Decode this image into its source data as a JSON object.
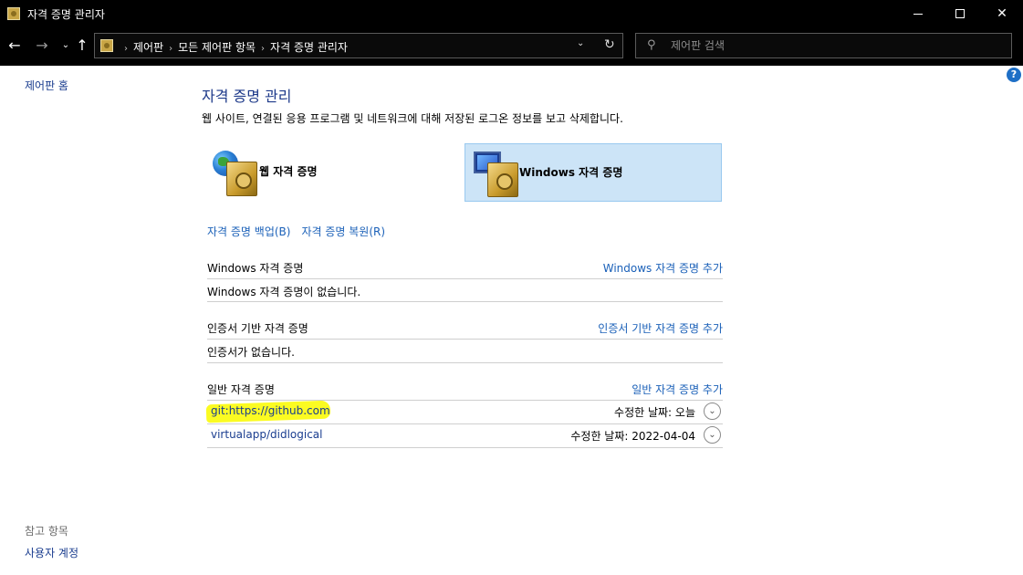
{
  "window": {
    "title": "자격 증명 관리자",
    "controls": {
      "minimize": "",
      "maximize": "",
      "close": "✕"
    }
  },
  "nav": {
    "back": "←",
    "forward": "→",
    "recent": "⌄",
    "up": "↑",
    "breadcrumbs": [
      "제어판",
      "모든 제어판 항목",
      "자격 증명 관리자"
    ],
    "separator": "›",
    "dropdown": "⌄",
    "refresh": "↻",
    "search_placeholder": "제어판 검색",
    "search_icon": "⚲"
  },
  "help_icon": "?",
  "left_pane": {
    "home_link": "제어판 홈",
    "see_also_label": "참고 항목",
    "user_accounts_link": "사용자 계정"
  },
  "main": {
    "title": "자격 증명 관리",
    "description": "웹 사이트, 연결된 응용 프로그램 및 네트워크에 대해 저장된 로그온 정보를 보고 삭제합니다.",
    "categories": [
      {
        "label": "웹 자격 증명",
        "icon": "web-vault-icon",
        "selected": false
      },
      {
        "label": "Windows 자격 증명",
        "icon": "windows-vault-icon",
        "selected": true
      }
    ],
    "backup_link": "자격 증명 백업(B)",
    "restore_link": "자격 증명 복원(R)",
    "sections": {
      "windows": {
        "header": "Windows 자격 증명",
        "add_link": "Windows 자격 증명 추가",
        "empty_msg": "Windows 자격 증명이 없습니다."
      },
      "certificate": {
        "header": "인증서 기반 자격 증명",
        "add_link": "인증서 기반 자격 증명 추가",
        "empty_msg": "인증서가 없습니다."
      },
      "generic": {
        "header": "일반 자격 증명",
        "add_link": "일반 자격 증명 추가",
        "items": [
          {
            "name": "git:https://github.com",
            "modified": "수정한 날짜:  오늘",
            "expand": "⌄",
            "highlighted": true
          },
          {
            "name": "virtualapp/didlogical",
            "modified": "수정한 날짜:  2022-04-04",
            "expand": "⌄",
            "highlighted": false
          }
        ]
      }
    }
  },
  "colors": {
    "link": "#1a60b8",
    "title": "#1e3a8a",
    "selected_tile": "#cce4f7",
    "highlight": "#fbfb22",
    "chrome": "#000000"
  }
}
